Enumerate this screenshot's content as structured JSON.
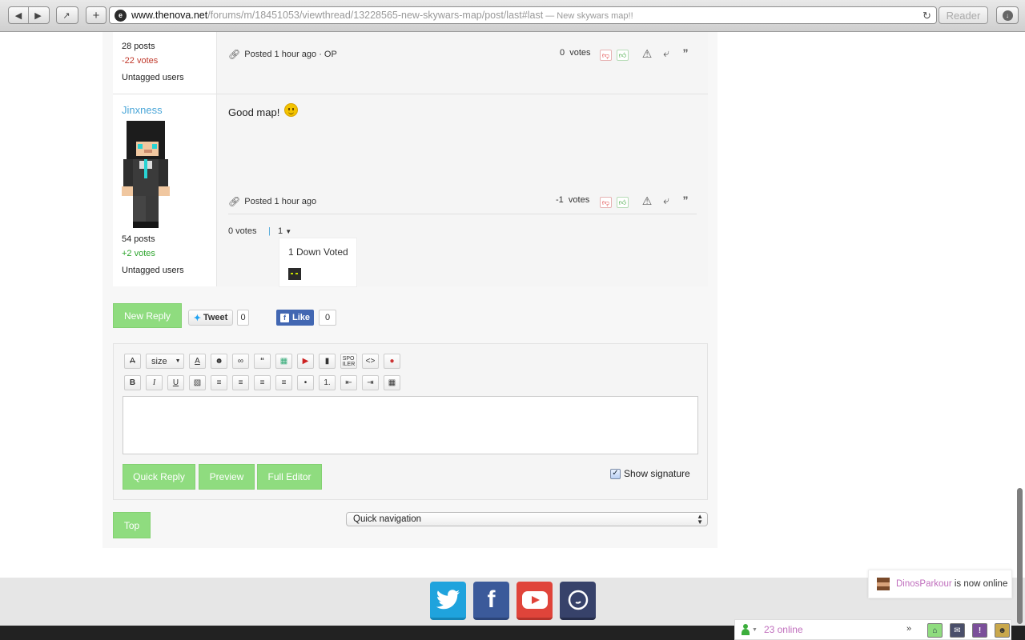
{
  "browser": {
    "url_host": "www.thenova.net",
    "url_path": "/forums/m/18451053/viewthread/13228565-new-skywars-map/post/last#last",
    "page_title_suffix": " — New skywars map!!",
    "reader_label": "Reader"
  },
  "post1": {
    "posts": "28 posts",
    "votes": "-22 votes",
    "group": "Untagged users",
    "posted": "Posted 1 hour ago · OP",
    "vote_count": "0",
    "votes_label": "votes"
  },
  "post2": {
    "username": "Jinxness",
    "body": "Good map!",
    "posts": "54 posts",
    "votes": "+2 votes",
    "group": "Untagged users",
    "posted": "Posted 1 hour ago",
    "vote_count": "-1",
    "votes_label": "votes",
    "footer_votes": "0 votes",
    "pipe": "|",
    "voters_count": "1",
    "voters_popup": "1 Down Voted"
  },
  "actions": {
    "new_reply": "New Reply",
    "tweet": "Tweet",
    "tweet_count": "0",
    "like": "Like",
    "like_count": "0"
  },
  "editor": {
    "size_label": "size",
    "quick_reply": "Quick Reply",
    "preview": "Preview",
    "full_editor": "Full Editor",
    "show_signature": "Show signature"
  },
  "nav": {
    "top": "Top",
    "quick_navigation": "Quick navigation"
  },
  "notifications": {
    "online_user": "DinosParkour",
    "online_text": " is now online",
    "online_count": "23 online"
  },
  "colors": {
    "accent_green": "#8fdc7f",
    "link_blue": "#4aa6d8",
    "negative": "#c0392b",
    "positive": "#2ea52e",
    "highlight_pink": "#c06fbd"
  }
}
